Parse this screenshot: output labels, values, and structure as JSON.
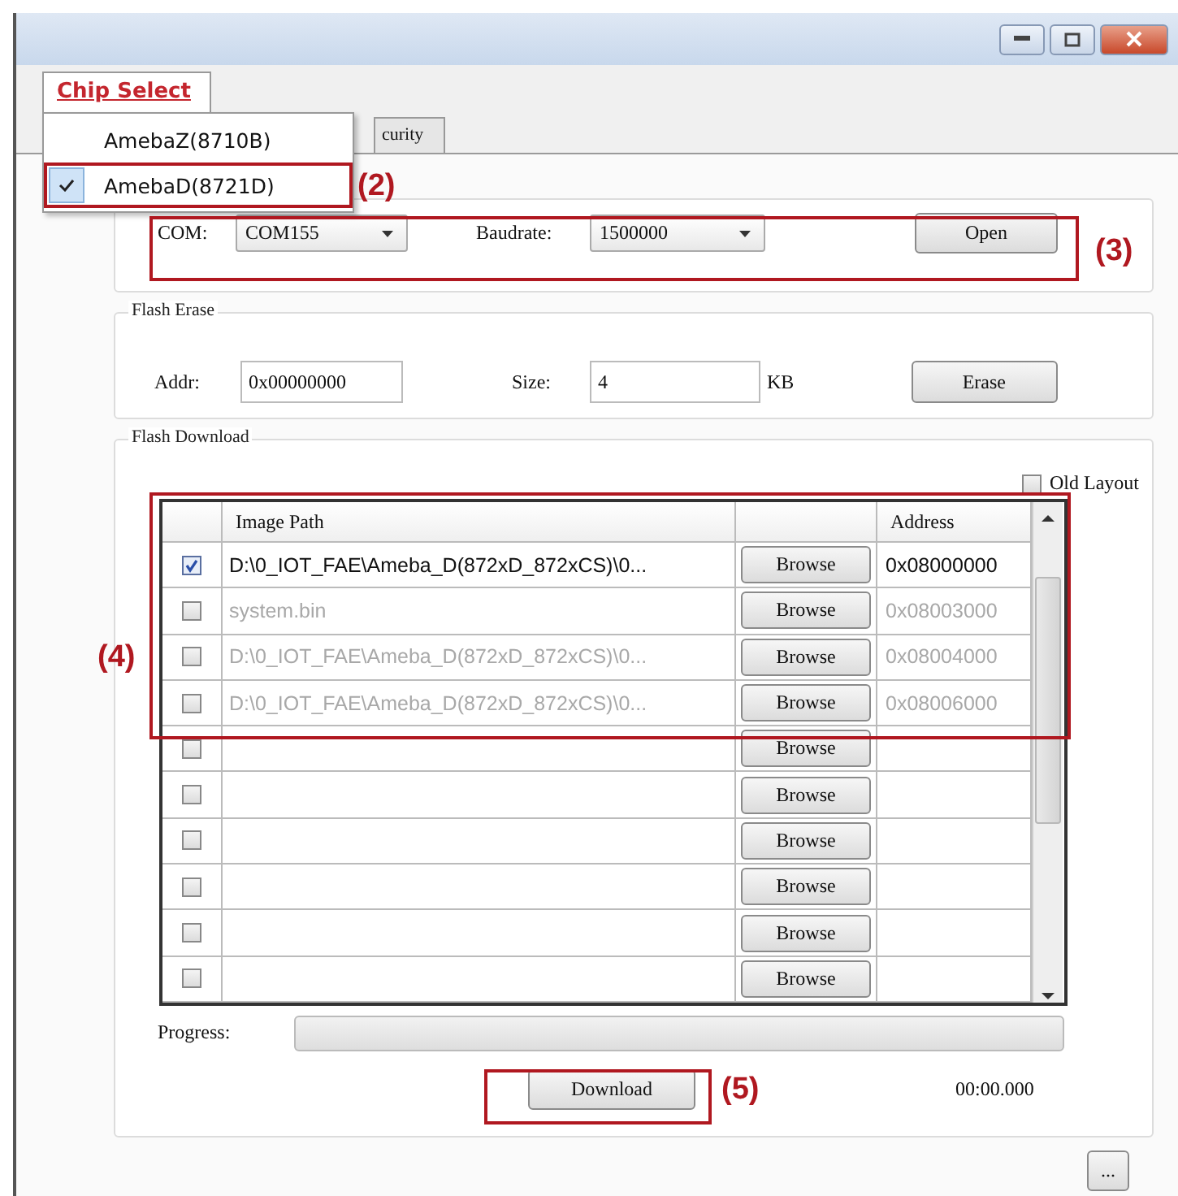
{
  "chip_menu": {
    "title": "Chip Select",
    "items": [
      {
        "label": "AmebaZ(8710B)",
        "checked": false
      },
      {
        "label": "AmebaD(8721D)",
        "checked": true
      }
    ]
  },
  "tabs": [
    {
      "label": "curity",
      "selected": false
    }
  ],
  "connection": {
    "com_label": "COM:",
    "com_value": "COM155",
    "baud_label": "Baudrate:",
    "baud_value": "1500000",
    "open_button": "Open"
  },
  "flash_erase": {
    "title": "Flash Erase",
    "addr_label": "Addr:",
    "addr_value": "0x00000000",
    "size_label": "Size:",
    "size_value": "4",
    "size_unit": "KB",
    "erase_button": "Erase"
  },
  "flash_download": {
    "title": "Flash Download",
    "old_layout": {
      "label": "Old Layout",
      "checked": false
    },
    "columns": [
      "Image Path",
      "Address"
    ],
    "rows": [
      {
        "checked": true,
        "path": "D:\\0_IOT_FAE\\Ameba_D(872xD_872xCS)\\0...",
        "browse": "Browse",
        "address": "0x08000000"
      },
      {
        "checked": false,
        "path": "system.bin",
        "browse": "Browse",
        "address": "0x08003000"
      },
      {
        "checked": false,
        "path": "D:\\0_IOT_FAE\\Ameba_D(872xD_872xCS)\\0...",
        "browse": "Browse",
        "address": "0x08004000"
      },
      {
        "checked": false,
        "path": "D:\\0_IOT_FAE\\Ameba_D(872xD_872xCS)\\0...",
        "browse": "Browse",
        "address": "0x08006000"
      },
      {
        "checked": false,
        "browse": "Browse"
      },
      {
        "checked": false,
        "browse": "Browse"
      },
      {
        "checked": false,
        "browse": "Browse"
      },
      {
        "checked": false,
        "browse": "Browse"
      },
      {
        "checked": false,
        "browse": "Browse"
      },
      {
        "checked": false,
        "browse": "Browse"
      }
    ],
    "progress": {
      "label": "Progress:",
      "level": 0
    },
    "download_button": "Download",
    "elapsed": "00:00.000"
  },
  "more_button": "...",
  "annotations": [
    {
      "label": "(2)"
    },
    {
      "label": "(3)"
    },
    {
      "label": "(4)"
    },
    {
      "label": "(5)"
    }
  ]
}
